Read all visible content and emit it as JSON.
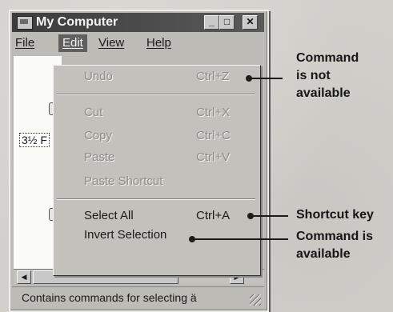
{
  "window": {
    "title": "My Computer",
    "controls": {
      "minimize": "_",
      "maximize": "□",
      "close": "✕"
    }
  },
  "menubar": {
    "items": [
      {
        "label": "File"
      },
      {
        "label": "Edit",
        "active": true
      },
      {
        "label": "View"
      },
      {
        "label": "Help"
      }
    ]
  },
  "client": {
    "drive_label": "3½ F"
  },
  "edit_menu": {
    "items": [
      {
        "label": "Undo",
        "shortcut": "Ctrl+Z",
        "enabled": false
      },
      {
        "label": "Cut",
        "shortcut": "Ctrl+X",
        "enabled": false
      },
      {
        "label": "Copy",
        "shortcut": "Ctrl+C",
        "enabled": false
      },
      {
        "label": "Paste",
        "shortcut": "Ctrl+V",
        "enabled": false
      },
      {
        "label": "Paste Shortcut",
        "shortcut": "",
        "enabled": false
      },
      {
        "label": "Select All",
        "shortcut": "Ctrl+A",
        "enabled": true
      },
      {
        "label": "Invert Selection",
        "shortcut": "",
        "enabled": true
      }
    ]
  },
  "statusbar": {
    "text": "Contains commands for selecting ä"
  },
  "annotations": {
    "not_available": [
      "Command",
      "is not",
      "available"
    ],
    "shortcut_key": "Shortcut key",
    "available": [
      "Command is",
      "available"
    ]
  }
}
